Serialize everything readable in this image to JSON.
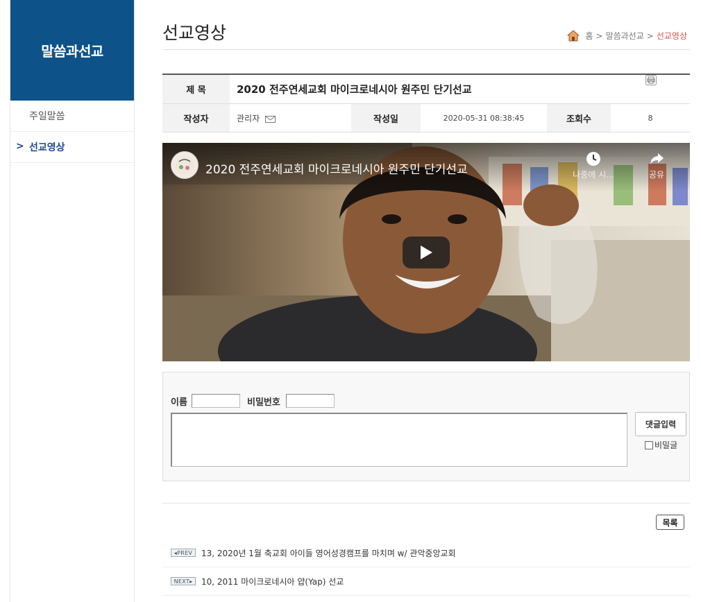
{
  "sidebar": {
    "title": "말씀과선교",
    "items": [
      {
        "label": "주일말씀",
        "active": false
      },
      {
        "label": "선교영상",
        "active": true
      }
    ]
  },
  "header": {
    "page_title": "선교영상",
    "breadcrumb": [
      "홈",
      "말씀과선교",
      "선교영상"
    ]
  },
  "post": {
    "subject_label": "제 목",
    "subject": "2020 전주연세교회 마이크로네시아 원주민 단기선교",
    "author_label": "작성자",
    "author": "관리자",
    "date_label": "작성일",
    "date": "2020-05-31 08:38:45",
    "views_label": "조회수",
    "views": "8"
  },
  "video": {
    "title": "2020 전주연세교회 마이크로네시아 원주민 단기선교",
    "watch_later": "나중에 시...",
    "share": "공유"
  },
  "comment": {
    "name_label": "이름",
    "password_label": "비밀번호",
    "submit_label": "댓글입력",
    "secret_label": "비밀글"
  },
  "list_button": "목록",
  "nav": {
    "prev_badge": "PREV",
    "prev_text": "13, 2020년 1월 축교회 아이들 영어성경캠프를 마치며 w/ 관악중앙교회",
    "next_badge": "NEXT",
    "next_text": "10, 2011 마이크로네시아 얍(Yap) 선교"
  },
  "colors": {
    "sidebar_header": "#0d5289",
    "active_menu": "#1a4a86",
    "breadcrumb_current": "#d9534f"
  }
}
